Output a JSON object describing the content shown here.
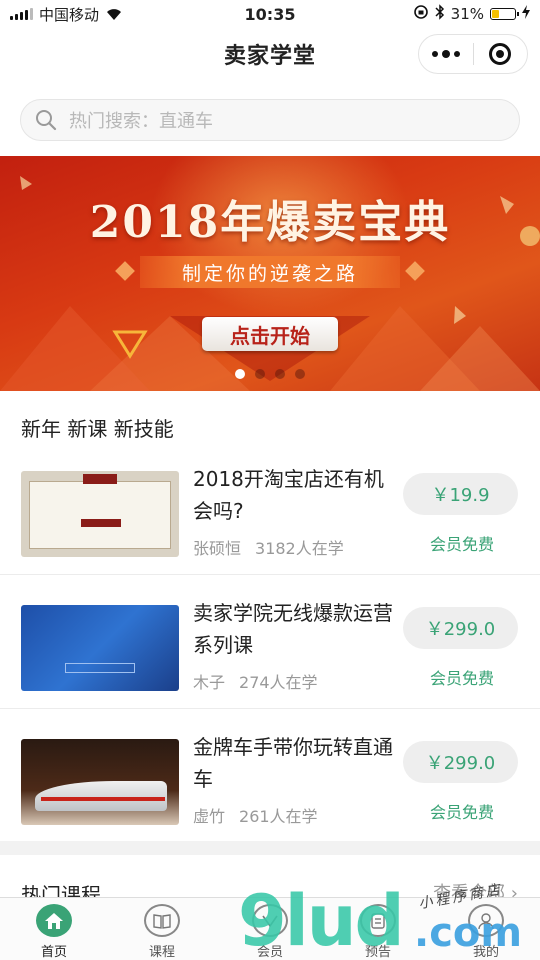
{
  "status_bar": {
    "carrier": "中国移动",
    "time": "10:35",
    "battery_percent": "31%",
    "battery_level": 0.31,
    "icons": [
      "signal-icon",
      "wifi-icon",
      "orientation-lock-icon",
      "bluetooth-icon",
      "battery-icon",
      "charging-icon"
    ]
  },
  "nav": {
    "title": "卖家学堂",
    "icons": [
      "more-icon",
      "close-target-icon"
    ]
  },
  "search": {
    "placeholder": "热门搜索：直通车"
  },
  "banner": {
    "title": "2018年爆卖宝典",
    "subtitle": "制定你的逆袭之路",
    "button_label": "点击开始",
    "slide_count": 4,
    "active_slide": 1,
    "colors": {
      "primary": "#c2200f",
      "accent": "#f0782c"
    }
  },
  "courses_section": {
    "title": "新年 新课 新技能",
    "items": [
      {
        "title": "2018开淘宝店还有机会吗?",
        "teacher": "张硕恒",
        "learners": "3182人在学",
        "price": "￥19.9",
        "member_label": "会员免费"
      },
      {
        "title": "卖家学院无线爆款运营系列课",
        "teacher": "木子",
        "learners": "274人在学",
        "price": "￥299.0",
        "member_label": "会员免费"
      },
      {
        "title": "金牌车手带你玩转直通车",
        "teacher": "虚竹",
        "learners": "261人在学",
        "price": "￥299.0",
        "member_label": "会员免费"
      }
    ]
  },
  "hot_section": {
    "title": "热门课程",
    "see_all": "查看全部"
  },
  "tab_bar": {
    "tabs": [
      {
        "label": "首页",
        "icon": "home-icon",
        "active": true
      },
      {
        "label": "课程",
        "icon": "book-icon",
        "active": false
      },
      {
        "label": "会员",
        "icon": "vip-icon",
        "active": false
      },
      {
        "label": "预告",
        "icon": "preview-icon",
        "active": false
      },
      {
        "label": "我的",
        "icon": "profile-icon",
        "active": false
      }
    ]
  },
  "watermark": {
    "text": "9lud",
    "domain": ".com",
    "signature": "小程序商店"
  },
  "colors": {
    "brand_green": "#3aa376",
    "banner_red": "#c2200f"
  }
}
